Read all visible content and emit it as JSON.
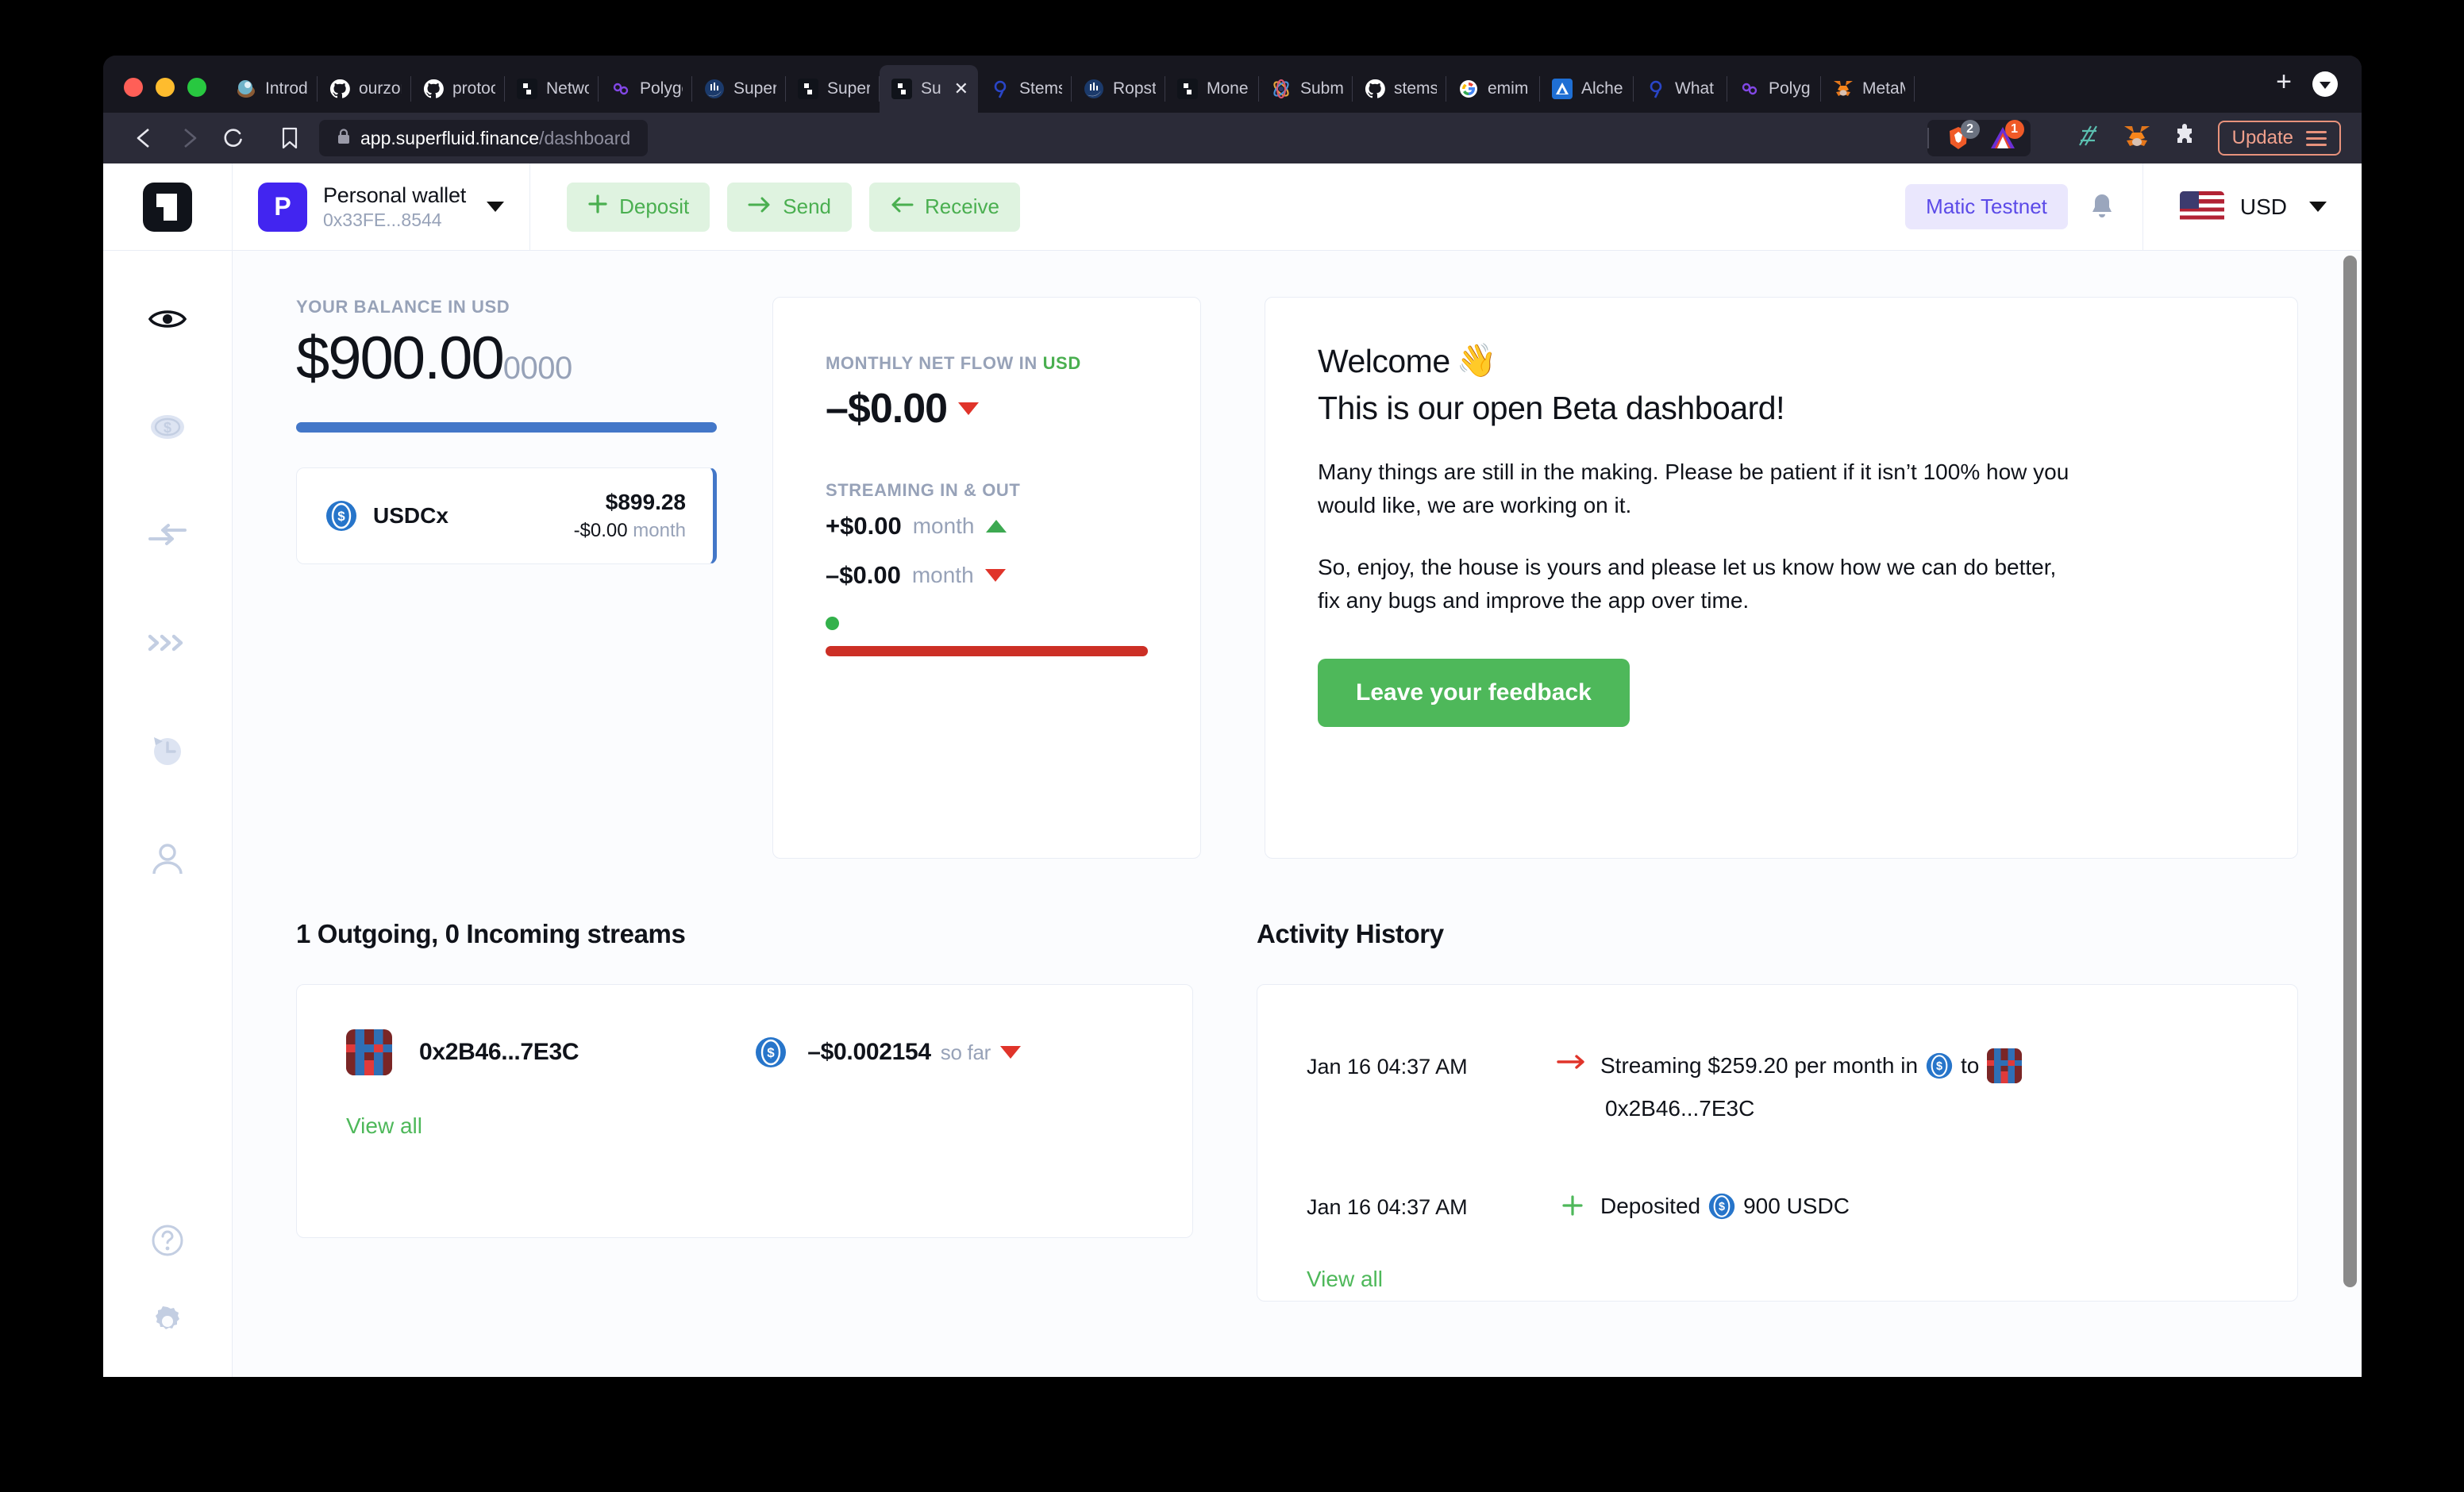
{
  "browser": {
    "traffic_lights": [
      "close",
      "minimize",
      "maximize"
    ],
    "tabs": [
      {
        "title": "Introd",
        "favicon": "gradient-orb-icon",
        "active": false
      },
      {
        "title": "ourzor",
        "favicon": "github-icon",
        "active": false
      },
      {
        "title": "protoc",
        "favicon": "github-icon",
        "active": false
      },
      {
        "title": "Netwo",
        "favicon": "superfluid-icon",
        "active": false
      },
      {
        "title": "Polygo",
        "favicon": "polygon-icon",
        "active": false
      },
      {
        "title": "Super",
        "favicon": "ropsten-icon",
        "active": false
      },
      {
        "title": "Super",
        "favicon": "superfluid-icon",
        "active": false
      },
      {
        "title": "Su",
        "favicon": "superfluid-icon",
        "active": true,
        "close_label": "✕"
      },
      {
        "title": "Stems",
        "favicon": "qmark-blue-icon",
        "active": false
      },
      {
        "title": "Ropst",
        "favicon": "ropsten-icon",
        "active": false
      },
      {
        "title": "Mone",
        "favicon": "superfluid-icon",
        "active": false
      },
      {
        "title": "Subm",
        "favicon": "atom-icon",
        "active": false
      },
      {
        "title": "stems",
        "favicon": "github-icon",
        "active": false
      },
      {
        "title": "emim",
        "favicon": "google-icon",
        "active": false
      },
      {
        "title": "Alche",
        "favicon": "alchemy-icon",
        "active": false
      },
      {
        "title": "What",
        "favicon": "qmark-blue-icon",
        "active": false
      },
      {
        "title": "Polyg",
        "favicon": "polygon-icon",
        "active": false
      },
      {
        "title": "MetaM",
        "favicon": "metamask-icon",
        "active": false
      }
    ],
    "new_tab_label": "+",
    "nav": {
      "back_icon": "back-arrow-icon",
      "forward_icon": "forward-arrow-icon",
      "reload_icon": "reload-icon",
      "bookmark_icon": "bookmark-icon",
      "lock_icon": "lock-icon"
    },
    "url": {
      "host": "app.superfluid.finance",
      "path": "/dashboard"
    },
    "shields": [
      {
        "icon": "brave-lion-icon",
        "count": "2",
        "count_color": "#6b7280"
      },
      {
        "icon": "brave-rewards-triangle-icon",
        "count": "1",
        "count_color": "#f05a28"
      }
    ],
    "extensions": [
      "numbers-icon",
      "metamask-fox-icon",
      "puzzle-extensions-icon"
    ],
    "update_button": {
      "label": "Update",
      "menu_icon": "hamburger-icon",
      "color": "#e8927c"
    }
  },
  "app": {
    "logo": "superfluid-logo-icon",
    "wallet": {
      "avatar_letter": "P",
      "name": "Personal wallet",
      "address": "0x33FE...8544",
      "caret_icon": "chevron-down-icon"
    },
    "actions": [
      {
        "label": "Deposit",
        "icon": "plus-icon"
      },
      {
        "label": "Send",
        "icon": "arrow-right-icon"
      },
      {
        "label": "Receive",
        "icon": "arrow-left-icon"
      }
    ],
    "network_badge": "Matic Testnet",
    "bell_icon": "bell-icon",
    "currency": {
      "flag": "us-flag-icon",
      "label": "USD",
      "caret_icon": "chevron-down-icon"
    },
    "sidebar": [
      {
        "name": "dashboard",
        "icon": "eye-icon",
        "active": true
      },
      {
        "name": "tokens",
        "icon": "dollar-coin-icon",
        "active": false
      },
      {
        "name": "transfers",
        "icon": "transfer-arrows-icon",
        "active": false
      },
      {
        "name": "streams",
        "icon": "chevrons-right-icon",
        "active": false
      },
      {
        "name": "history",
        "icon": "clock-history-icon",
        "active": false
      },
      {
        "name": "account",
        "icon": "person-icon",
        "active": false
      }
    ],
    "sidebar_bottom": [
      {
        "name": "help",
        "icon": "help-circle-icon"
      },
      {
        "name": "settings",
        "icon": "gear-icon"
      }
    ]
  },
  "balance_card": {
    "kicker": "YOUR BALANCE IN USD",
    "amount_main": "$900.00",
    "amount_decimals": "0000",
    "bar_color": "#4377c8",
    "token": {
      "icon": "usdc-icon",
      "symbol": "USDCx",
      "value": "$899.28",
      "rate": "-$0.00",
      "rate_unit": "month"
    }
  },
  "flow_card": {
    "kicker_prefix": "MONTHLY NET FLOW IN ",
    "kicker_currency": "USD",
    "net_flow": "–$0.00",
    "net_flow_trend": "down",
    "streaming_kicker": "STREAMING IN & OUT",
    "inflow": {
      "amount": "+$0.00",
      "unit": "month",
      "trend": "up"
    },
    "outflow": {
      "amount": "–$0.00",
      "unit": "month",
      "trend": "down"
    },
    "dot_color": "#33b14b",
    "bar_color": "#cc2f25"
  },
  "welcome_card": {
    "title": "Welcome",
    "title_emoji": "👋",
    "subtitle": "This is our open Beta dashboard!",
    "paragraph1": "Many things are still in the making. Please be patient if it isn’t 100% how you would like, we are working on it.",
    "paragraph2": "So, enjoy, the house is yours and please let us know how we can do better, fix any bugs and improve the app over time.",
    "cta_label": "Leave your feedback"
  },
  "streams_section": {
    "title": "1 Outgoing, 0 Incoming streams",
    "rows": [
      {
        "avatar": "blockie-icon",
        "address": "0x2B46...7E3C",
        "token_icon": "usdc-icon",
        "amount": "–$0.002154",
        "amount_unit": "so far",
        "trend": "down"
      }
    ],
    "view_all_label": "View all"
  },
  "activity_section": {
    "title": "Activity History",
    "rows": [
      {
        "time": "Jan 16 04:37 AM",
        "icon": "arrow-right-red-icon",
        "text_before": "Streaming $259.20 per month in",
        "token_icon": "usdc-icon",
        "text_middle": "to",
        "recipient_avatar": "blockie-icon",
        "text_after": "0x2B46...7E3C"
      },
      {
        "time": "Jan 16 04:37 AM",
        "icon": "plus-green-icon",
        "text_before": "Deposited",
        "token_icon": "usdc-icon",
        "text_after": "900 USDC"
      }
    ],
    "view_all_label": "View all"
  }
}
